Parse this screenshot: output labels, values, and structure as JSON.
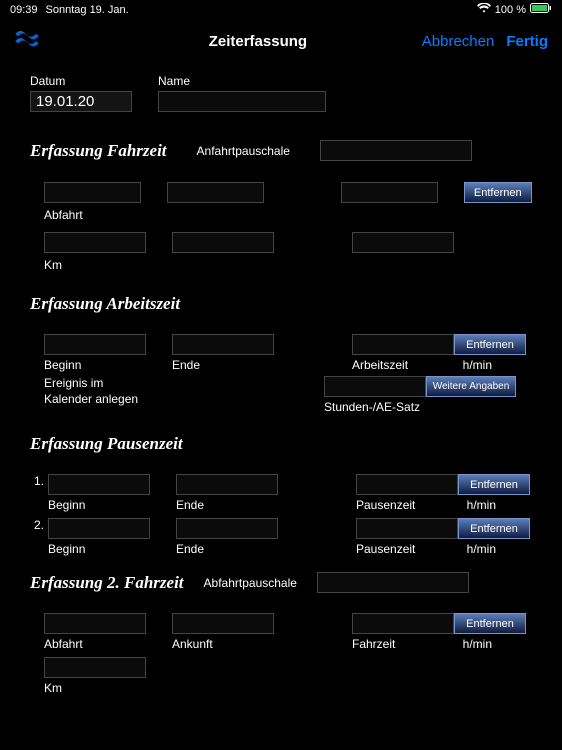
{
  "statusbar": {
    "time": "09:39",
    "date": "Sonntag 19. Jan.",
    "battery": "100 %"
  },
  "nav": {
    "title": "Zeiterfassung",
    "cancel": "Abbrechen",
    "done": "Fertig"
  },
  "top": {
    "datum_label": "Datum",
    "datum_value": "19.01.20",
    "name_label": "Name",
    "name_value": ""
  },
  "sec1": {
    "title": "Erfassung Fahrzeit",
    "anfahrt_label": "Anfahrtpauschale",
    "entfernen": "Entfernen",
    "abfahrt": "Abfahrt",
    "km": "Km"
  },
  "sec2": {
    "title": "Erfassung Arbeitszeit",
    "entfernen": "Entfernen",
    "beginn": "Beginn",
    "ende": "Ende",
    "arbeitszeit": "Arbeitszeit",
    "hmin": "h/min",
    "ereignis": "Ereignis im Kalender anlegen",
    "weitere": "Weitere Angaben",
    "stunden": "Stunden-/AE-Satz"
  },
  "sec3": {
    "title": "Erfassung Pausenzeit",
    "n1": "1.",
    "n2": "2.",
    "beginn": "Beginn",
    "ende": "Ende",
    "pausenzeit": "Pausenzeit",
    "hmin": "h/min",
    "entfernen": "Entfernen"
  },
  "sec4": {
    "title": "Erfassung 2. Fahrzeit",
    "abfahrt_label": "Abfahrtpauschale",
    "entfernen": "Entfernen",
    "abfahrt": "Abfahrt",
    "ankunft": "Ankunft",
    "fahrzeit": "Fahrzeit",
    "hmin": "h/min",
    "km": "Km"
  }
}
